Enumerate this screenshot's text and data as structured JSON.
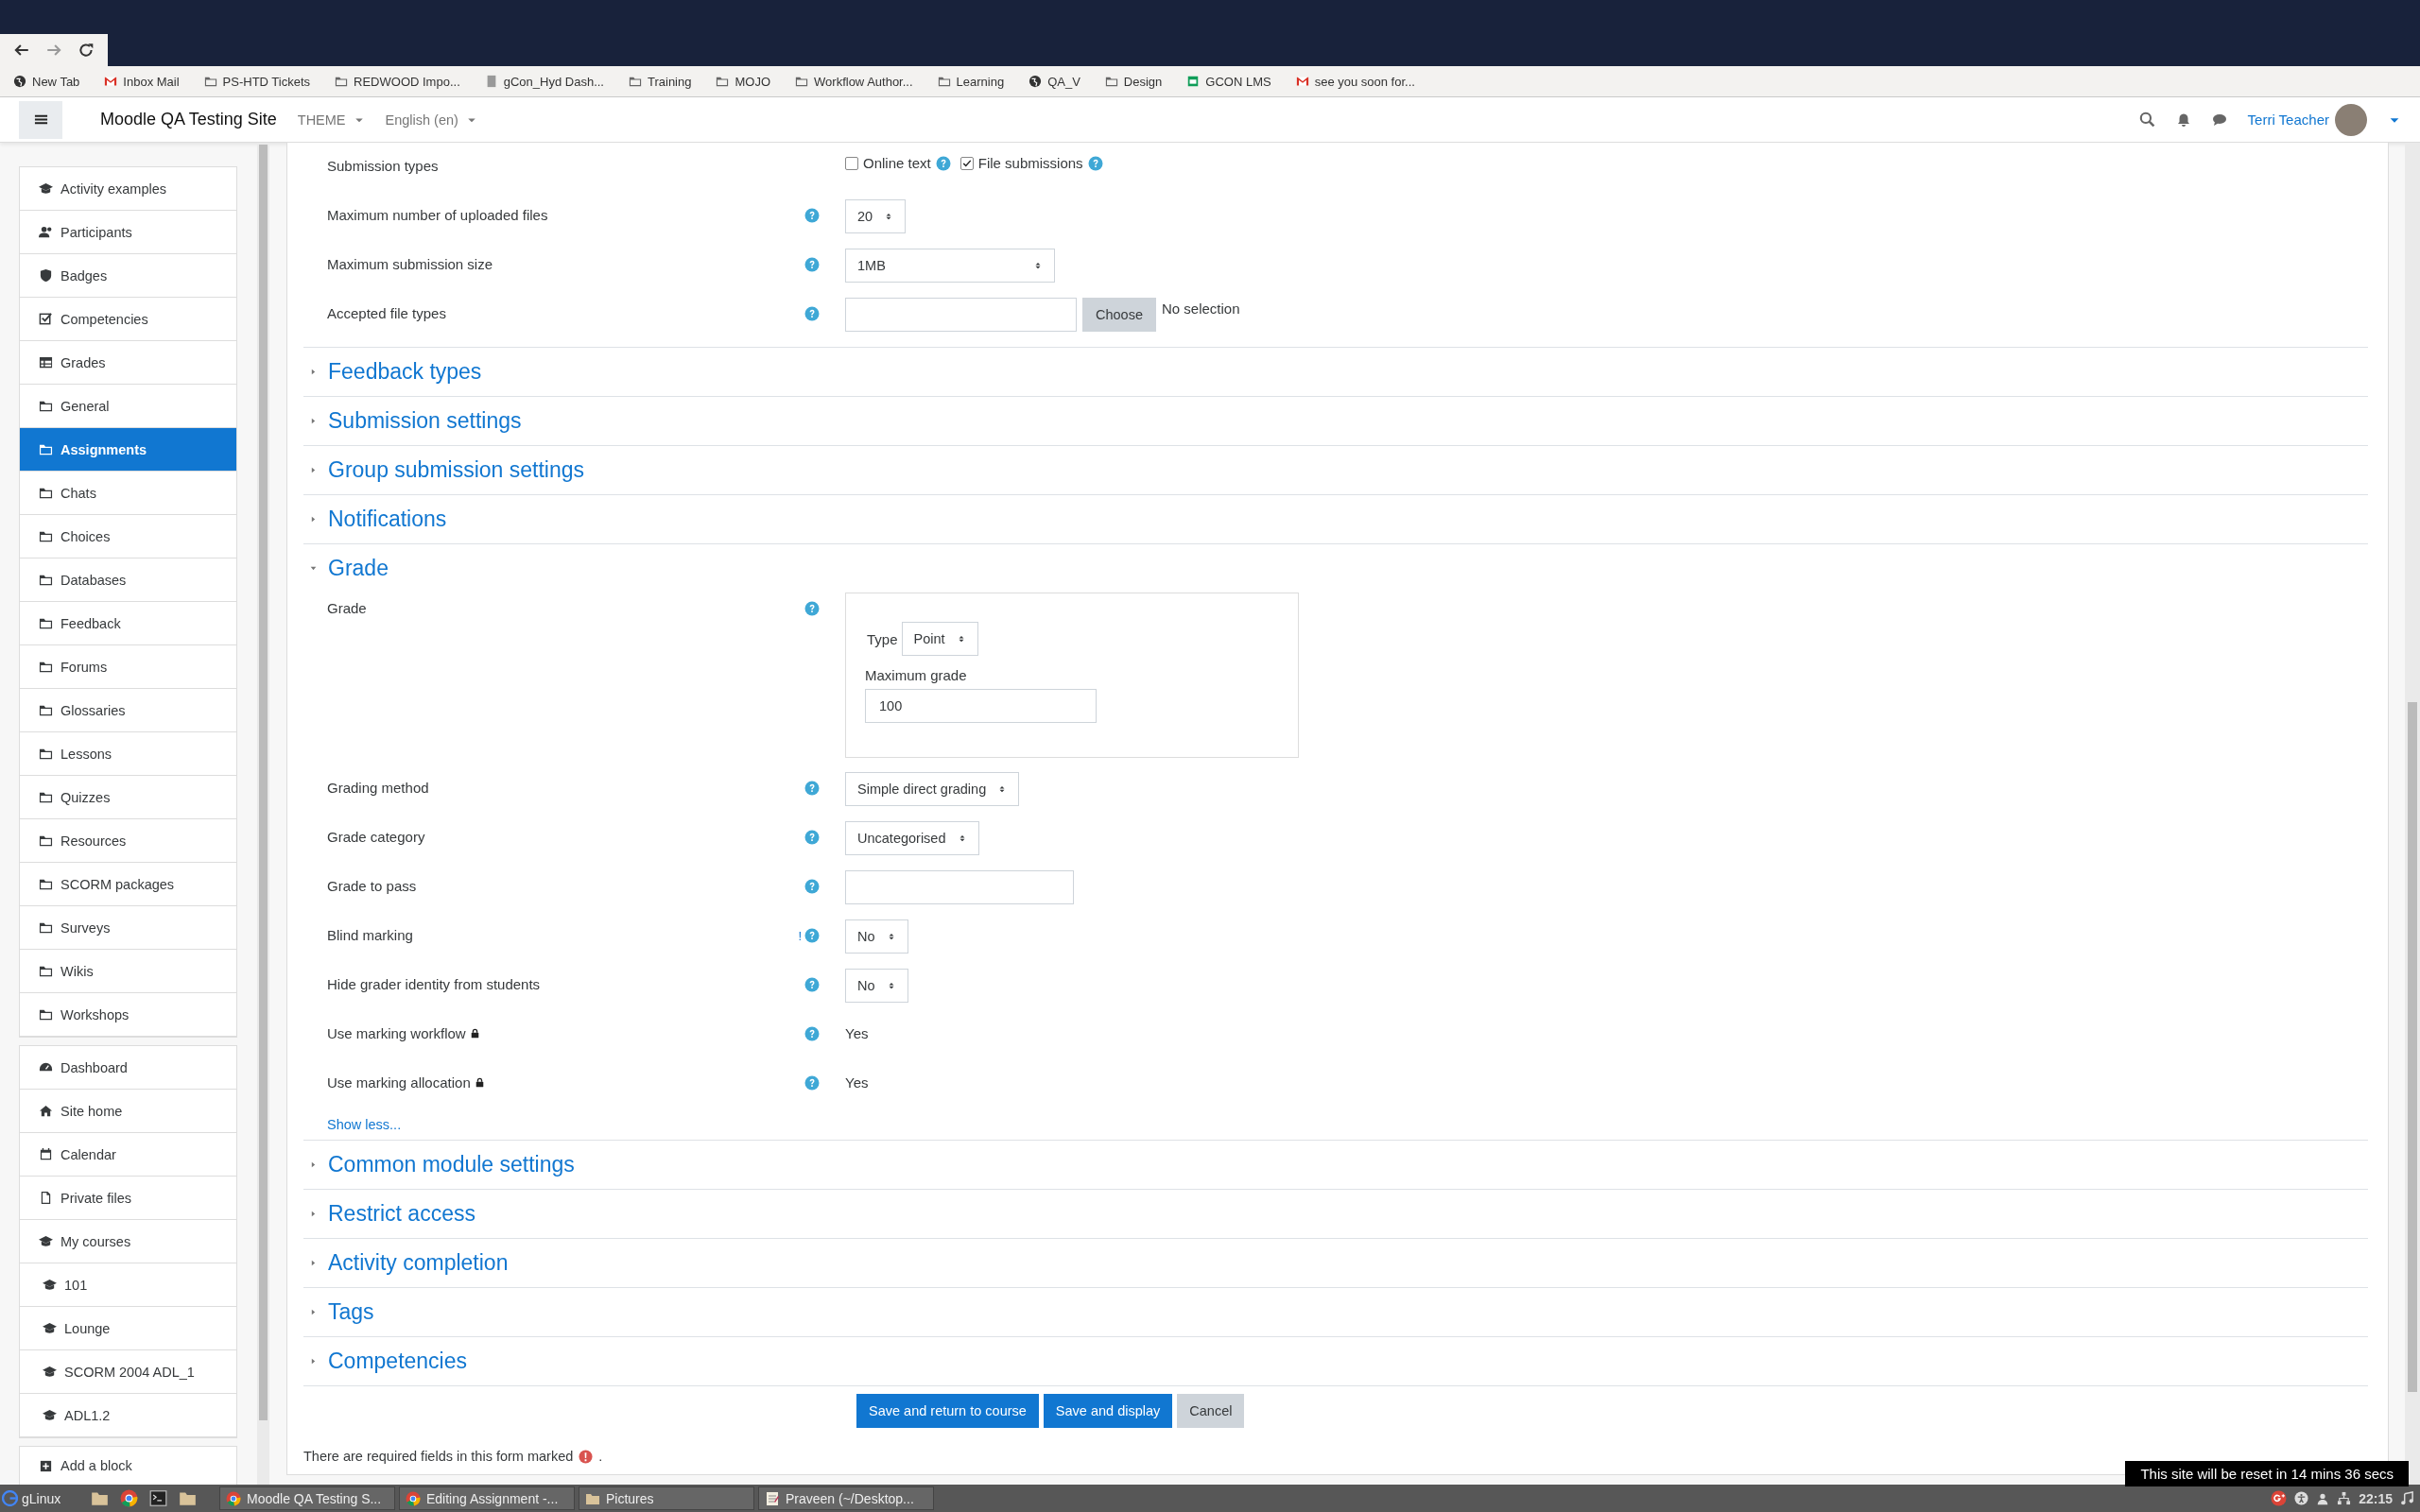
{
  "browser": {
    "bookmarks": [
      "New Tab",
      "Inbox Mail",
      "PS-HTD Tickets",
      "REDWOOD Impo...",
      "gCon_Hyd Dash...",
      "Training",
      "MOJO",
      "Workflow Author...",
      "Learning",
      "QA_V",
      "Design",
      "GCON LMS",
      "see you soon for..."
    ]
  },
  "navbar": {
    "site_name": "Moodle QA Testing Site",
    "menus": [
      "THEME",
      "English (en)"
    ],
    "user": "Terri Teacher"
  },
  "sidebar": {
    "blocks": [
      {
        "items": [
          {
            "label": "Activity examples",
            "selected": false
          },
          {
            "label": "Participants",
            "selected": false
          },
          {
            "label": "Badges",
            "selected": false
          },
          {
            "label": "Competencies",
            "selected": false
          },
          {
            "label": "Grades",
            "selected": false
          },
          {
            "label": "General",
            "selected": false
          },
          {
            "label": "Assignments",
            "selected": true
          },
          {
            "label": "Chats",
            "selected": false
          },
          {
            "label": "Choices",
            "selected": false
          },
          {
            "label": "Databases",
            "selected": false
          },
          {
            "label": "Feedback",
            "selected": false
          },
          {
            "label": "Forums",
            "selected": false
          },
          {
            "label": "Glossaries",
            "selected": false
          },
          {
            "label": "Lessons",
            "selected": false
          },
          {
            "label": "Quizzes",
            "selected": false
          },
          {
            "label": "Resources",
            "selected": false
          },
          {
            "label": "SCORM packages",
            "selected": false
          },
          {
            "label": "Surveys",
            "selected": false
          },
          {
            "label": "Wikis",
            "selected": false
          },
          {
            "label": "Workshops",
            "selected": false
          }
        ]
      },
      {
        "items": [
          {
            "label": "Dashboard",
            "selected": false
          },
          {
            "label": "Site home",
            "selected": false
          },
          {
            "label": "Calendar",
            "selected": false
          },
          {
            "label": "Private files",
            "selected": false
          },
          {
            "label": "My courses",
            "selected": false,
            "children": [
              {
                "label": "101",
                "selected": false
              },
              {
                "label": "Lounge",
                "selected": false
              },
              {
                "label": "SCORM 2004 ADL_1",
                "selected": false
              },
              {
                "label": "ADL1.2",
                "selected": false
              }
            ]
          }
        ]
      }
    ],
    "add_block": "Add a block"
  },
  "form": {
    "top_rows": [
      {
        "kind": "checkboxes",
        "label": "Submission types",
        "options": [
          {
            "label": "Online text",
            "checked": false
          },
          {
            "label": "File submissions",
            "checked": true
          }
        ]
      },
      {
        "kind": "select",
        "label": "Maximum number of uploaded files",
        "help": true,
        "value": "20"
      },
      {
        "kind": "select",
        "label": "Maximum submission size",
        "help": true,
        "value": "1MB",
        "wide": true
      },
      {
        "kind": "filepicker",
        "label": "Accepted file types",
        "help": true,
        "button": "Choose",
        "status": "No selection"
      }
    ],
    "sections": [
      {
        "title": "Feedback types",
        "expanded": false
      },
      {
        "title": "Submission settings",
        "expanded": false
      },
      {
        "title": "Group submission settings",
        "expanded": false
      },
      {
        "title": "Notifications",
        "expanded": false
      },
      {
        "title": "Grade",
        "expanded": true,
        "rows": [
          {
            "kind": "gradebox",
            "label": "Grade",
            "help": true,
            "type_label": "Type",
            "type_value": "Point",
            "max_label": "Maximum grade",
            "max_value": "100"
          },
          {
            "kind": "select",
            "label": "Grading method",
            "help": true,
            "value": "Simple direct grading"
          },
          {
            "kind": "select",
            "label": "Grade category",
            "help": true,
            "value": "Uncategorised"
          },
          {
            "kind": "text",
            "label": "Grade to pass",
            "help": true
          },
          {
            "kind": "select",
            "label": "Blind marking",
            "help": true,
            "advanced_mark": "!",
            "value": "No"
          },
          {
            "kind": "select",
            "label": "Hide grader identity from students",
            "help": true,
            "value": "No"
          },
          {
            "kind": "static",
            "label": "Use marking workflow",
            "help": true,
            "locked": true,
            "value": "Yes"
          },
          {
            "kind": "static",
            "label": "Use marking allocation",
            "help": true,
            "locked": true,
            "value": "Yes"
          }
        ],
        "show_less": "Show less..."
      },
      {
        "title": "Common module settings",
        "expanded": false
      },
      {
        "title": "Restrict access",
        "expanded": false
      },
      {
        "title": "Activity completion",
        "expanded": false
      },
      {
        "title": "Tags",
        "expanded": false
      },
      {
        "title": "Competencies",
        "expanded": false
      }
    ],
    "buttons": [
      {
        "label": "Save and return to course",
        "kind": "primary"
      },
      {
        "label": "Save and display",
        "kind": "primary"
      },
      {
        "label": "Cancel",
        "kind": "secondary"
      }
    ],
    "required_notice": {
      "text": "There are required fields in this form marked",
      "end": "."
    }
  },
  "toast": "This site will be reset in 14 mins 36 secs",
  "taskbar": {
    "start": "gLinux",
    "windows": [
      "Moodle QA Testing S...",
      "Editing Assignment -...",
      "Pictures",
      "Praveen (~/Desktop..."
    ],
    "clock": "22:15"
  }
}
